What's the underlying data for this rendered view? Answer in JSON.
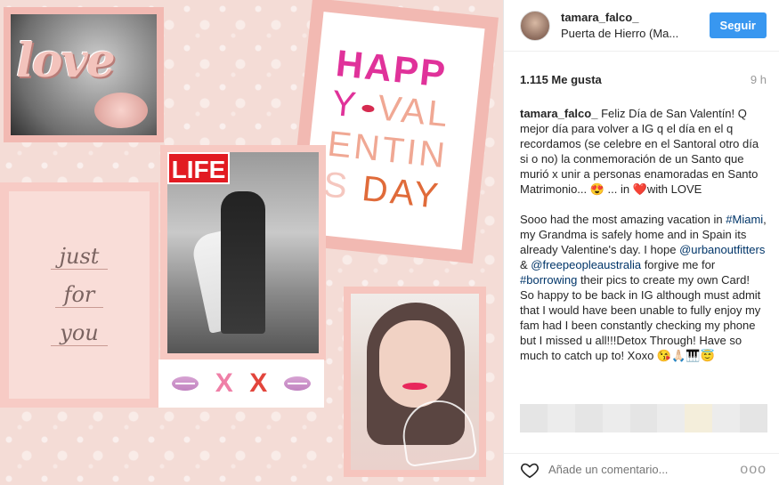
{
  "post": {
    "username": "tamara_falco_",
    "location": "Puerta de Hierro (Ma...",
    "follow_label": "Seguir",
    "likes": "1.115 Me gusta",
    "time": "9 h",
    "caption_user": "tamara_falco_",
    "caption_p1": "Feliz Día de San Valentín! Q mejor día para volver a IG q el día en el q recordamos (se celebre en el Santoral otro día si o no) la conmemoración de un Santo que murió x unir a personas enamoradas en Santo Matrimonio... 😍 ... in ❤️with LOVE",
    "caption_p2_a": "Sooo had the most amazing vacation in ",
    "tag_miami": "#Miami",
    "caption_p2_b": ", my Grandma is safely home and in Spain its already Valentine's day. I hope ",
    "mention_uo": "@urbanoutfitters",
    "caption_p2_c": " & ",
    "mention_fp": "@freepeopleaustralia",
    "caption_p2_d": " forgive me for ",
    "tag_borrowing": "#borrowing",
    "caption_p2_e": " their pics to create my own Card! So happy to be back in IG although must admit that I would have been unable to fully enjoy my fam had I been constantly checking my phone but I missed u all!!!Detox Through! Have so much to catch up to! Xoxo 😘🙏🏻🎹😇",
    "comment_placeholder": "Añade un comentario...",
    "more_label": "ooo"
  },
  "collage": {
    "love_text": "love",
    "happy": "HAPP",
    "val_line": "VAL",
    "val_y": "Y",
    "entin": "ENTIN",
    "is": "S",
    "day": "DAY",
    "life": "LIFE",
    "just": "just",
    "for": "for",
    "you": "you",
    "x": "X"
  },
  "icons": {
    "heart": "heart-icon",
    "more": "more-options-icon"
  },
  "colors": {
    "follow_button": "#3897f0",
    "link": "#003569",
    "card_pink": "#f2b9b2"
  }
}
